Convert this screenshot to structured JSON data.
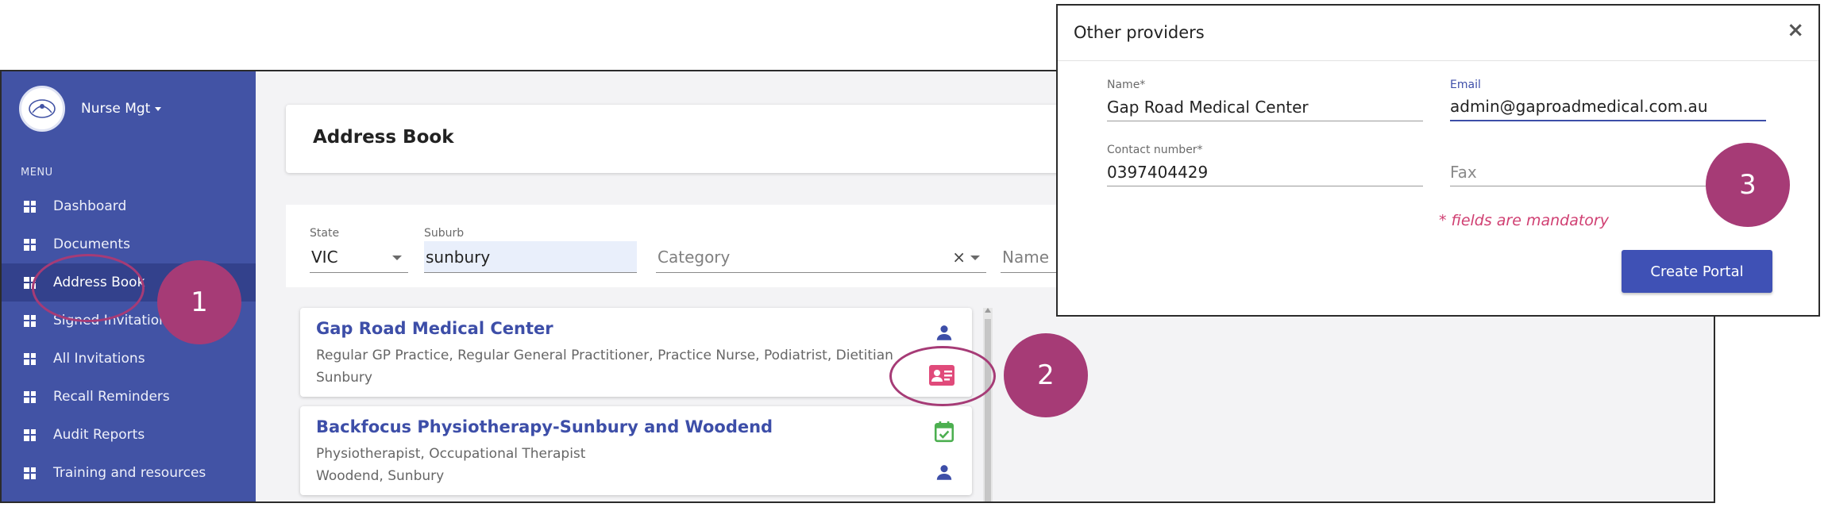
{
  "sidebar": {
    "brand": "Nurse Mgt",
    "menu_label": "MENU",
    "items": [
      {
        "label": "Dashboard"
      },
      {
        "label": "Documents"
      },
      {
        "label": "Address Book"
      },
      {
        "label": "Signed Invitations"
      },
      {
        "label": "All Invitations"
      },
      {
        "label": "Recall Reminders"
      },
      {
        "label": "Audit Reports"
      },
      {
        "label": "Training and resources"
      }
    ]
  },
  "header": {
    "title": "Address Book"
  },
  "filters": {
    "state": {
      "label": "State",
      "value": "VIC"
    },
    "suburb": {
      "label": "Suburb",
      "value": "sunbury"
    },
    "category": {
      "placeholder": "Category",
      "clear": "×"
    },
    "name": {
      "placeholder": "Name"
    }
  },
  "results": [
    {
      "title": "Gap Road Medical Center",
      "categories": "Regular GP Practice, Regular General Practitioner, Practice Nurse, Podiatrist, Dietitian",
      "location": "Sunbury",
      "icons": [
        "person-icon",
        "contact-card-icon"
      ]
    },
    {
      "title": "Backfocus Physiotherapy-Sunbury and Woodend",
      "categories": "Physiotherapist, Occupational Therapist",
      "location": "Woodend, Sunbury",
      "icons": [
        "calendar-check-icon",
        "person-icon"
      ]
    }
  ],
  "annotations": {
    "one": "1",
    "two": "2",
    "three": "3"
  },
  "modal": {
    "title": "Other providers",
    "close": "×",
    "name": {
      "label": "Name*",
      "value": "Gap Road Medical Center"
    },
    "email": {
      "label": "Email",
      "value": "admin@gaproadmedical.com.au"
    },
    "contact": {
      "label": "Contact number*",
      "value": "0397404429"
    },
    "fax": {
      "placeholder": "Fax"
    },
    "mandatory_note": "* fields are mandatory",
    "submit_label": "Create Portal"
  },
  "colors": {
    "sidebar": "#4253a5",
    "accent": "#3f51b5",
    "annotation": "#a63b76",
    "contact_icon": "#e04a7a",
    "calendar_icon": "#4caf50"
  }
}
